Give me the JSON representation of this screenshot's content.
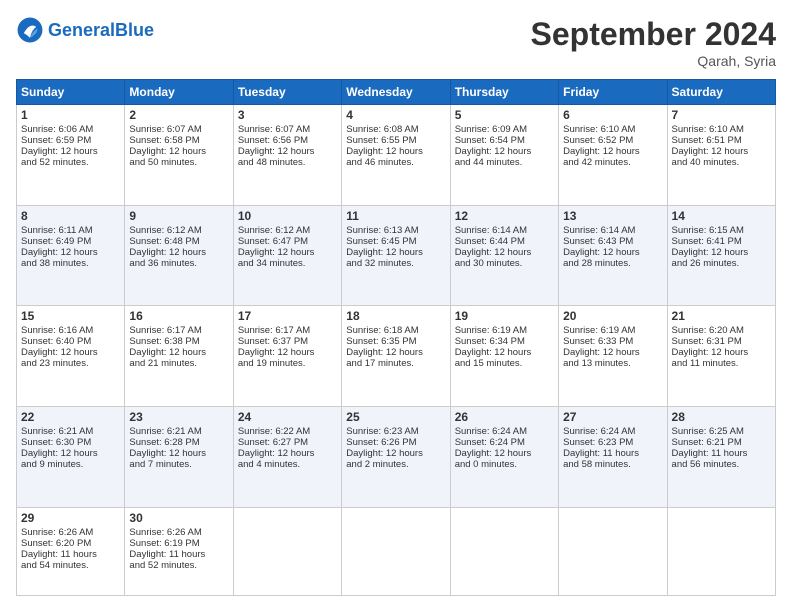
{
  "header": {
    "logo_general": "General",
    "logo_blue": "Blue",
    "month": "September 2024",
    "location": "Qarah, Syria"
  },
  "weekdays": [
    "Sunday",
    "Monday",
    "Tuesday",
    "Wednesday",
    "Thursday",
    "Friday",
    "Saturday"
  ],
  "weeks": [
    [
      {
        "day": 1,
        "lines": [
          "Sunrise: 6:06 AM",
          "Sunset: 6:59 PM",
          "Daylight: 12 hours",
          "and 52 minutes."
        ]
      },
      {
        "day": 2,
        "lines": [
          "Sunrise: 6:07 AM",
          "Sunset: 6:58 PM",
          "Daylight: 12 hours",
          "and 50 minutes."
        ]
      },
      {
        "day": 3,
        "lines": [
          "Sunrise: 6:07 AM",
          "Sunset: 6:56 PM",
          "Daylight: 12 hours",
          "and 48 minutes."
        ]
      },
      {
        "day": 4,
        "lines": [
          "Sunrise: 6:08 AM",
          "Sunset: 6:55 PM",
          "Daylight: 12 hours",
          "and 46 minutes."
        ]
      },
      {
        "day": 5,
        "lines": [
          "Sunrise: 6:09 AM",
          "Sunset: 6:54 PM",
          "Daylight: 12 hours",
          "and 44 minutes."
        ]
      },
      {
        "day": 6,
        "lines": [
          "Sunrise: 6:10 AM",
          "Sunset: 6:52 PM",
          "Daylight: 12 hours",
          "and 42 minutes."
        ]
      },
      {
        "day": 7,
        "lines": [
          "Sunrise: 6:10 AM",
          "Sunset: 6:51 PM",
          "Daylight: 12 hours",
          "and 40 minutes."
        ]
      }
    ],
    [
      {
        "day": 8,
        "lines": [
          "Sunrise: 6:11 AM",
          "Sunset: 6:49 PM",
          "Daylight: 12 hours",
          "and 38 minutes."
        ]
      },
      {
        "day": 9,
        "lines": [
          "Sunrise: 6:12 AM",
          "Sunset: 6:48 PM",
          "Daylight: 12 hours",
          "and 36 minutes."
        ]
      },
      {
        "day": 10,
        "lines": [
          "Sunrise: 6:12 AM",
          "Sunset: 6:47 PM",
          "Daylight: 12 hours",
          "and 34 minutes."
        ]
      },
      {
        "day": 11,
        "lines": [
          "Sunrise: 6:13 AM",
          "Sunset: 6:45 PM",
          "Daylight: 12 hours",
          "and 32 minutes."
        ]
      },
      {
        "day": 12,
        "lines": [
          "Sunrise: 6:14 AM",
          "Sunset: 6:44 PM",
          "Daylight: 12 hours",
          "and 30 minutes."
        ]
      },
      {
        "day": 13,
        "lines": [
          "Sunrise: 6:14 AM",
          "Sunset: 6:43 PM",
          "Daylight: 12 hours",
          "and 28 minutes."
        ]
      },
      {
        "day": 14,
        "lines": [
          "Sunrise: 6:15 AM",
          "Sunset: 6:41 PM",
          "Daylight: 12 hours",
          "and 26 minutes."
        ]
      }
    ],
    [
      {
        "day": 15,
        "lines": [
          "Sunrise: 6:16 AM",
          "Sunset: 6:40 PM",
          "Daylight: 12 hours",
          "and 23 minutes."
        ]
      },
      {
        "day": 16,
        "lines": [
          "Sunrise: 6:17 AM",
          "Sunset: 6:38 PM",
          "Daylight: 12 hours",
          "and 21 minutes."
        ]
      },
      {
        "day": 17,
        "lines": [
          "Sunrise: 6:17 AM",
          "Sunset: 6:37 PM",
          "Daylight: 12 hours",
          "and 19 minutes."
        ]
      },
      {
        "day": 18,
        "lines": [
          "Sunrise: 6:18 AM",
          "Sunset: 6:35 PM",
          "Daylight: 12 hours",
          "and 17 minutes."
        ]
      },
      {
        "day": 19,
        "lines": [
          "Sunrise: 6:19 AM",
          "Sunset: 6:34 PM",
          "Daylight: 12 hours",
          "and 15 minutes."
        ]
      },
      {
        "day": 20,
        "lines": [
          "Sunrise: 6:19 AM",
          "Sunset: 6:33 PM",
          "Daylight: 12 hours",
          "and 13 minutes."
        ]
      },
      {
        "day": 21,
        "lines": [
          "Sunrise: 6:20 AM",
          "Sunset: 6:31 PM",
          "Daylight: 12 hours",
          "and 11 minutes."
        ]
      }
    ],
    [
      {
        "day": 22,
        "lines": [
          "Sunrise: 6:21 AM",
          "Sunset: 6:30 PM",
          "Daylight: 12 hours",
          "and 9 minutes."
        ]
      },
      {
        "day": 23,
        "lines": [
          "Sunrise: 6:21 AM",
          "Sunset: 6:28 PM",
          "Daylight: 12 hours",
          "and 7 minutes."
        ]
      },
      {
        "day": 24,
        "lines": [
          "Sunrise: 6:22 AM",
          "Sunset: 6:27 PM",
          "Daylight: 12 hours",
          "and 4 minutes."
        ]
      },
      {
        "day": 25,
        "lines": [
          "Sunrise: 6:23 AM",
          "Sunset: 6:26 PM",
          "Daylight: 12 hours",
          "and 2 minutes."
        ]
      },
      {
        "day": 26,
        "lines": [
          "Sunrise: 6:24 AM",
          "Sunset: 6:24 PM",
          "Daylight: 12 hours",
          "and 0 minutes."
        ]
      },
      {
        "day": 27,
        "lines": [
          "Sunrise: 6:24 AM",
          "Sunset: 6:23 PM",
          "Daylight: 11 hours",
          "and 58 minutes."
        ]
      },
      {
        "day": 28,
        "lines": [
          "Sunrise: 6:25 AM",
          "Sunset: 6:21 PM",
          "Daylight: 11 hours",
          "and 56 minutes."
        ]
      }
    ],
    [
      {
        "day": 29,
        "lines": [
          "Sunrise: 6:26 AM",
          "Sunset: 6:20 PM",
          "Daylight: 11 hours",
          "and 54 minutes."
        ]
      },
      {
        "day": 30,
        "lines": [
          "Sunrise: 6:26 AM",
          "Sunset: 6:19 PM",
          "Daylight: 11 hours",
          "and 52 minutes."
        ]
      },
      null,
      null,
      null,
      null,
      null
    ]
  ]
}
